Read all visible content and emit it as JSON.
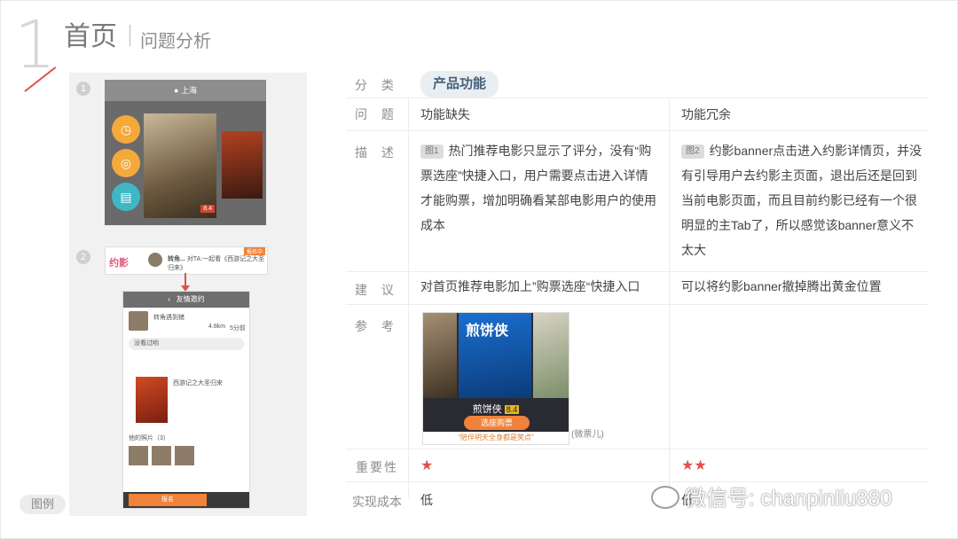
{
  "header": {
    "number": "1",
    "title": "首页",
    "subtitle": "问题分析"
  },
  "left": {
    "badge1": "1",
    "badge2": "2",
    "shot1": {
      "city": "上海",
      "rating": "8.4"
    },
    "shot2": {
      "logo": "约影",
      "name": "转角...",
      "text": "对TA:一起看《西游记之大圣归来》",
      "tag": "报名中"
    },
    "phone": {
      "topbar": "友情邀约",
      "user": "转角遇到猪",
      "distance": "4.8km",
      "time": "5分前",
      "invite_note": "没看过哟",
      "movie": "西游记之大圣归来",
      "photos_label": "他的照片（3）",
      "signup": "报名"
    },
    "legend": "图例"
  },
  "table": {
    "category_label": "分 类",
    "category_value": "产品功能",
    "problem_label": "问 题",
    "problem_col1": "功能缺失",
    "problem_col2": "功能冗余",
    "desc_label": "描 述",
    "desc_col1_tag": "图1",
    "desc_col1": "热门推荐电影只显示了评分，没有“购票选座”快捷入口，用户需要点击进入详情才能购票，增加明确看某部电影用户的使用成本",
    "desc_col2_tag": "图2",
    "desc_col2": "约影banner点击进入约影详情页，并没有引导用户去约影主页面，退出后还是回到当前电影页面，而且目前约影已经有一个很明显的主Tab了，所以感觉该banner意义不太大",
    "suggest_label": "建 议",
    "suggest_col1": "对首页推荐电影加上”购票选座“快捷入口",
    "suggest_col2": "可以将约影banner撤掉腾出黄金位置",
    "ref_label": "参 考",
    "ref_image": {
      "movie": "煎饼侠",
      "rating": "8.4",
      "buy": "选座购票",
      "quote": "“陪伴明天全身都是笑点”",
      "poster_title": "煎饼侠"
    },
    "ref_caption": "(微票儿)",
    "importance_label": "重要性",
    "importance_col1": "★",
    "importance_col2": "★★",
    "cost_label": "实现成本",
    "cost_col1": "低",
    "cost_col2": "低"
  },
  "watermark": "微信号: chanpinliu880",
  "colors": {
    "accent": "#e0524a",
    "pill_bg": "#e9eef2",
    "pill_text": "#45617a"
  }
}
